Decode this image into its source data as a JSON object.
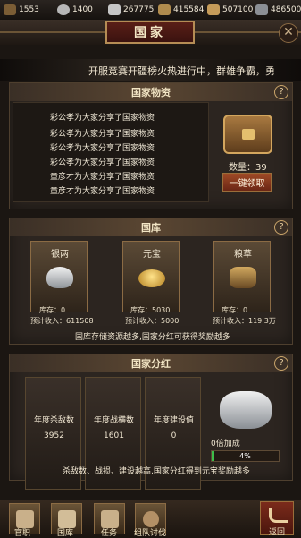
{
  "resources": [
    {
      "icon": "throne-icon",
      "value": "1553",
      "color": "#7b5d35"
    },
    {
      "icon": "silver-coin-icon",
      "value": "1400",
      "color": "#b7b7b7"
    },
    {
      "icon": "silver-ingot-icon",
      "value": "267775",
      "color": "#c6c6c6"
    },
    {
      "icon": "wood-icon",
      "value": "415584",
      "color": "#b18c4e"
    },
    {
      "icon": "arrow-icon",
      "value": "507100",
      "color": "#c59b59"
    },
    {
      "icon": "iron-icon",
      "value": "486500",
      "color": "#8b8f95"
    }
  ],
  "title": "国家",
  "marquee": "开服竞赛开疆榜火热进行中，群雄争霸，勇",
  "sections": {
    "supplies": {
      "title": "国家物资",
      "help": "?",
      "messages": [
        "彩公孝为大家分享了国家物资",
        "彩公孝为大家分享了国家物资",
        "彩公孝为大家分享了国家物资",
        "彩公孝为大家分享了国家物资",
        "童彦才为大家分享了国家物资",
        "童彦才为大家分享了国家物资"
      ],
      "count_label": "数量：39",
      "claim_button": "一键领取"
    },
    "treasury": {
      "title": "国库",
      "help": "?",
      "info": "国库存储资源越多,国家分红可获得奖励越多",
      "items": [
        {
          "label": "银两",
          "stock": "库存：0",
          "estimate": "预计收入：611508"
        },
        {
          "label": "元宝",
          "stock": "库存：5030",
          "estimate": "预计收入：5000"
        },
        {
          "label": "粮草",
          "stock": "库存：0",
          "estimate": "预计收入：119.3万"
        }
      ]
    },
    "dividend": {
      "title": "国家分红",
      "help": "?",
      "stats": [
        {
          "label": "年度杀敌数",
          "value": "3952"
        },
        {
          "label": "年度战横数",
          "value": "1601"
        },
        {
          "label": "年度建设值",
          "value": "0"
        }
      ],
      "bonus_label": "0倍加成",
      "progress": "4%",
      "footer": "杀敌数、战损、建设越高,国家分红得到元宝奖励越多"
    }
  },
  "bottom_nav": [
    {
      "label": "官职",
      "icon": "office-icon"
    },
    {
      "label": "国库",
      "icon": "treasury-icon"
    },
    {
      "label": "任务",
      "icon": "task-icon"
    },
    {
      "label": "组队讨伐",
      "icon": "crossed-swords-icon"
    }
  ],
  "back_label": "返回"
}
